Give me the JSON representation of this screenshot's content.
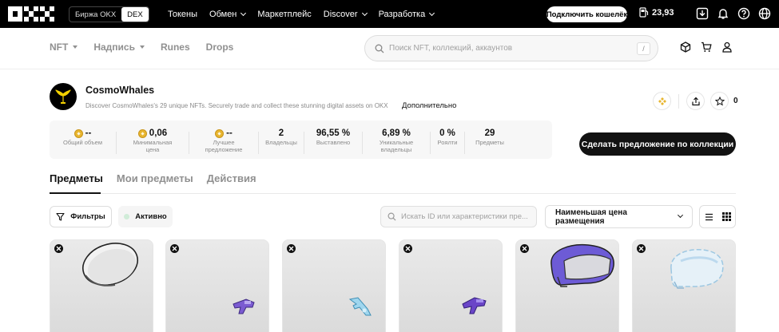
{
  "topbar": {
    "exchange_toggle": [
      "Биржа OKX",
      "DEX"
    ],
    "nav": [
      {
        "label": "Токены",
        "dropdown": false
      },
      {
        "label": "Обмен",
        "dropdown": true
      },
      {
        "label": "Маркетплейс",
        "dropdown": false
      },
      {
        "label": "Discover",
        "dropdown": true
      },
      {
        "label": "Разработка",
        "dropdown": true
      }
    ],
    "connect_wallet": "Подключить кошелёк",
    "balance": "23,93",
    "icons": [
      "download-icon",
      "bell-icon",
      "help-icon",
      "globe-icon"
    ]
  },
  "subnav": {
    "tabs": [
      {
        "label": "NFT",
        "dropdown": true
      },
      {
        "label": "Надпись",
        "dropdown": true
      },
      {
        "label": "Runes",
        "dropdown": false
      },
      {
        "label": "Drops",
        "dropdown": false
      }
    ],
    "search_placeholder": "Поиск NFT, коллекций, аккаунтов",
    "search_shortcut": "/",
    "icons": [
      "cube-icon",
      "cart-icon",
      "user-icon"
    ]
  },
  "collection": {
    "name": "CosmoWhales",
    "description": "Discover CosmoWhales's 29 unique NFTs. Securely trade and collect these stunning digital assets on OKX",
    "more_label": "Дополнительно",
    "favorites_count": "0",
    "stats": [
      {
        "value": "--",
        "label": "Общий объем",
        "coin": true
      },
      {
        "value": "0,06",
        "label": "Минимальная цена",
        "coin": true
      },
      {
        "value": "--",
        "label": "Лучшее предложение",
        "coin": true
      },
      {
        "value": "2",
        "label": "Владельцы",
        "coin": false
      },
      {
        "value": "96,55 %",
        "label": "Выставлено",
        "coin": false
      },
      {
        "value": "6,89 %",
        "label": "Уникальные владельцы",
        "coin": false
      },
      {
        "value": "0 %",
        "label": "Роялти",
        "coin": false
      },
      {
        "value": "29",
        "label": "Предметы",
        "coin": false
      }
    ],
    "offer_button": "Сделать предложение по коллекции"
  },
  "content_tabs": [
    {
      "label": "Предметы",
      "active": true
    },
    {
      "label": "Мои предметы",
      "active": false
    },
    {
      "label": "Действия",
      "active": false
    }
  ],
  "filters": {
    "filter_button": "Фильтры",
    "status_chip": "Активно",
    "id_search_placeholder": "Искать ID или характеристики пре...",
    "sort_selected": "Наименьшая цена размещения"
  },
  "cards": [
    {
      "item": "oval-mirror"
    },
    {
      "item": "purple-blaster"
    },
    {
      "item": "blue-blaster"
    },
    {
      "item": "purple-blaster-2"
    },
    {
      "item": "purple-visor-helmet"
    },
    {
      "item": "glass-helmet"
    }
  ],
  "colors": {
    "topbar_bg": "#000000",
    "accent_dark": "#121212",
    "coin": "#e8b52f",
    "active_dot": "#d0ecd8"
  }
}
